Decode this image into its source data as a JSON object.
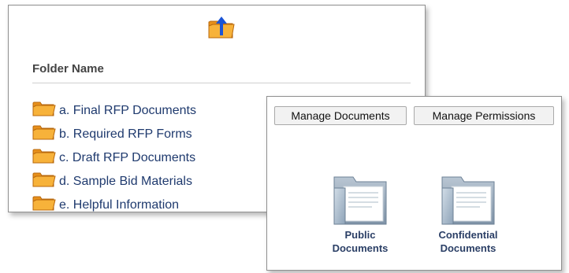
{
  "folder_panel": {
    "up_icon": "folder-up-icon",
    "column_header": "Folder Name",
    "folders": [
      {
        "label": "a. Final RFP Documents"
      },
      {
        "label": "b. Required RFP Forms"
      },
      {
        "label": "c. Draft RFP Documents"
      },
      {
        "label": "d. Sample Bid Materials"
      },
      {
        "label": "e. Helpful Information"
      }
    ]
  },
  "documents_panel": {
    "manage_documents_label": "Manage Documents",
    "manage_permissions_label": "Manage Permissions",
    "public_line1": "Public",
    "public_line2": "Documents",
    "confidential_line1": "Confidential",
    "confidential_line2": "Documents"
  },
  "colors": {
    "folder_orange": "#f5a623",
    "arrow_blue": "#1b54d6",
    "label_navy": "#1f3a6e"
  }
}
